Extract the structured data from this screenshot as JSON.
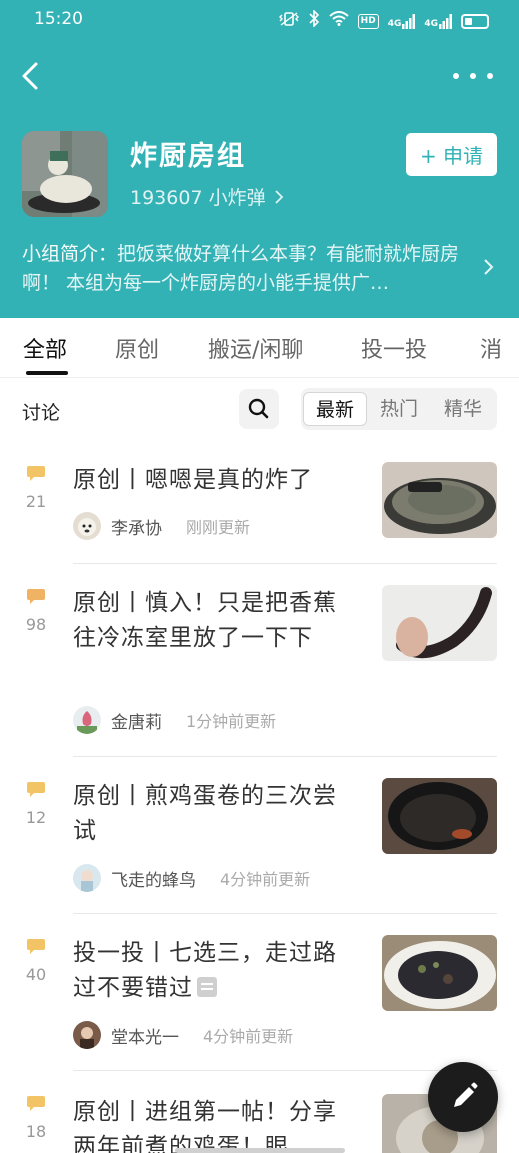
{
  "status_bar": {
    "time": "15:20",
    "hd": "HD",
    "sig1": "4G",
    "sig2": "4G"
  },
  "group": {
    "name": "炸厨房组",
    "meta": "193607 小炸弹",
    "apply_label": "+ 申请",
    "intro_label": "小组简介：",
    "intro_text": "把饭菜做好算什么本事？有能耐就炸厨房啊！  本组为每一个炸厨房的小能手提供广…"
  },
  "tabs": [
    "全部",
    "原创",
    "搬运/闲聊",
    "投一投",
    "消"
  ],
  "filter": {
    "label": "讨论",
    "sort_options": [
      "最新",
      "热门",
      "精华"
    ]
  },
  "posts": [
    {
      "count": "21",
      "title": "原创丨嗯嗯是真的炸了",
      "author": "李承协",
      "time": "刚刚更新"
    },
    {
      "count": "98",
      "title": "原创丨慎入！只是把香蕉往冷冻室里放了一下下",
      "author": "金唐莉",
      "time": "1分钟前更新"
    },
    {
      "count": "12",
      "title": "原创丨煎鸡蛋卷的三次尝试",
      "author": "飞走的蜂鸟",
      "time": "4分钟前更新"
    },
    {
      "count": "40",
      "title": "投一投丨七选三，走过路过不要错过",
      "author": "堂本光一",
      "time": "4分钟前更新"
    },
    {
      "count": "18",
      "title": "原创丨进组第一帖！分享两年前煮的鸡蛋！眼",
      "author": "",
      "time": ""
    }
  ],
  "colors": {
    "brand": "#33b2b6",
    "comment_icon": "#f0c060",
    "fab": "#1c1c1c"
  },
  "icons": [
    "back-arrow-icon",
    "more-dots-icon",
    "chevron-right-icon",
    "search-icon",
    "comment-bubble-icon",
    "document-icon",
    "pencil-icon"
  ]
}
